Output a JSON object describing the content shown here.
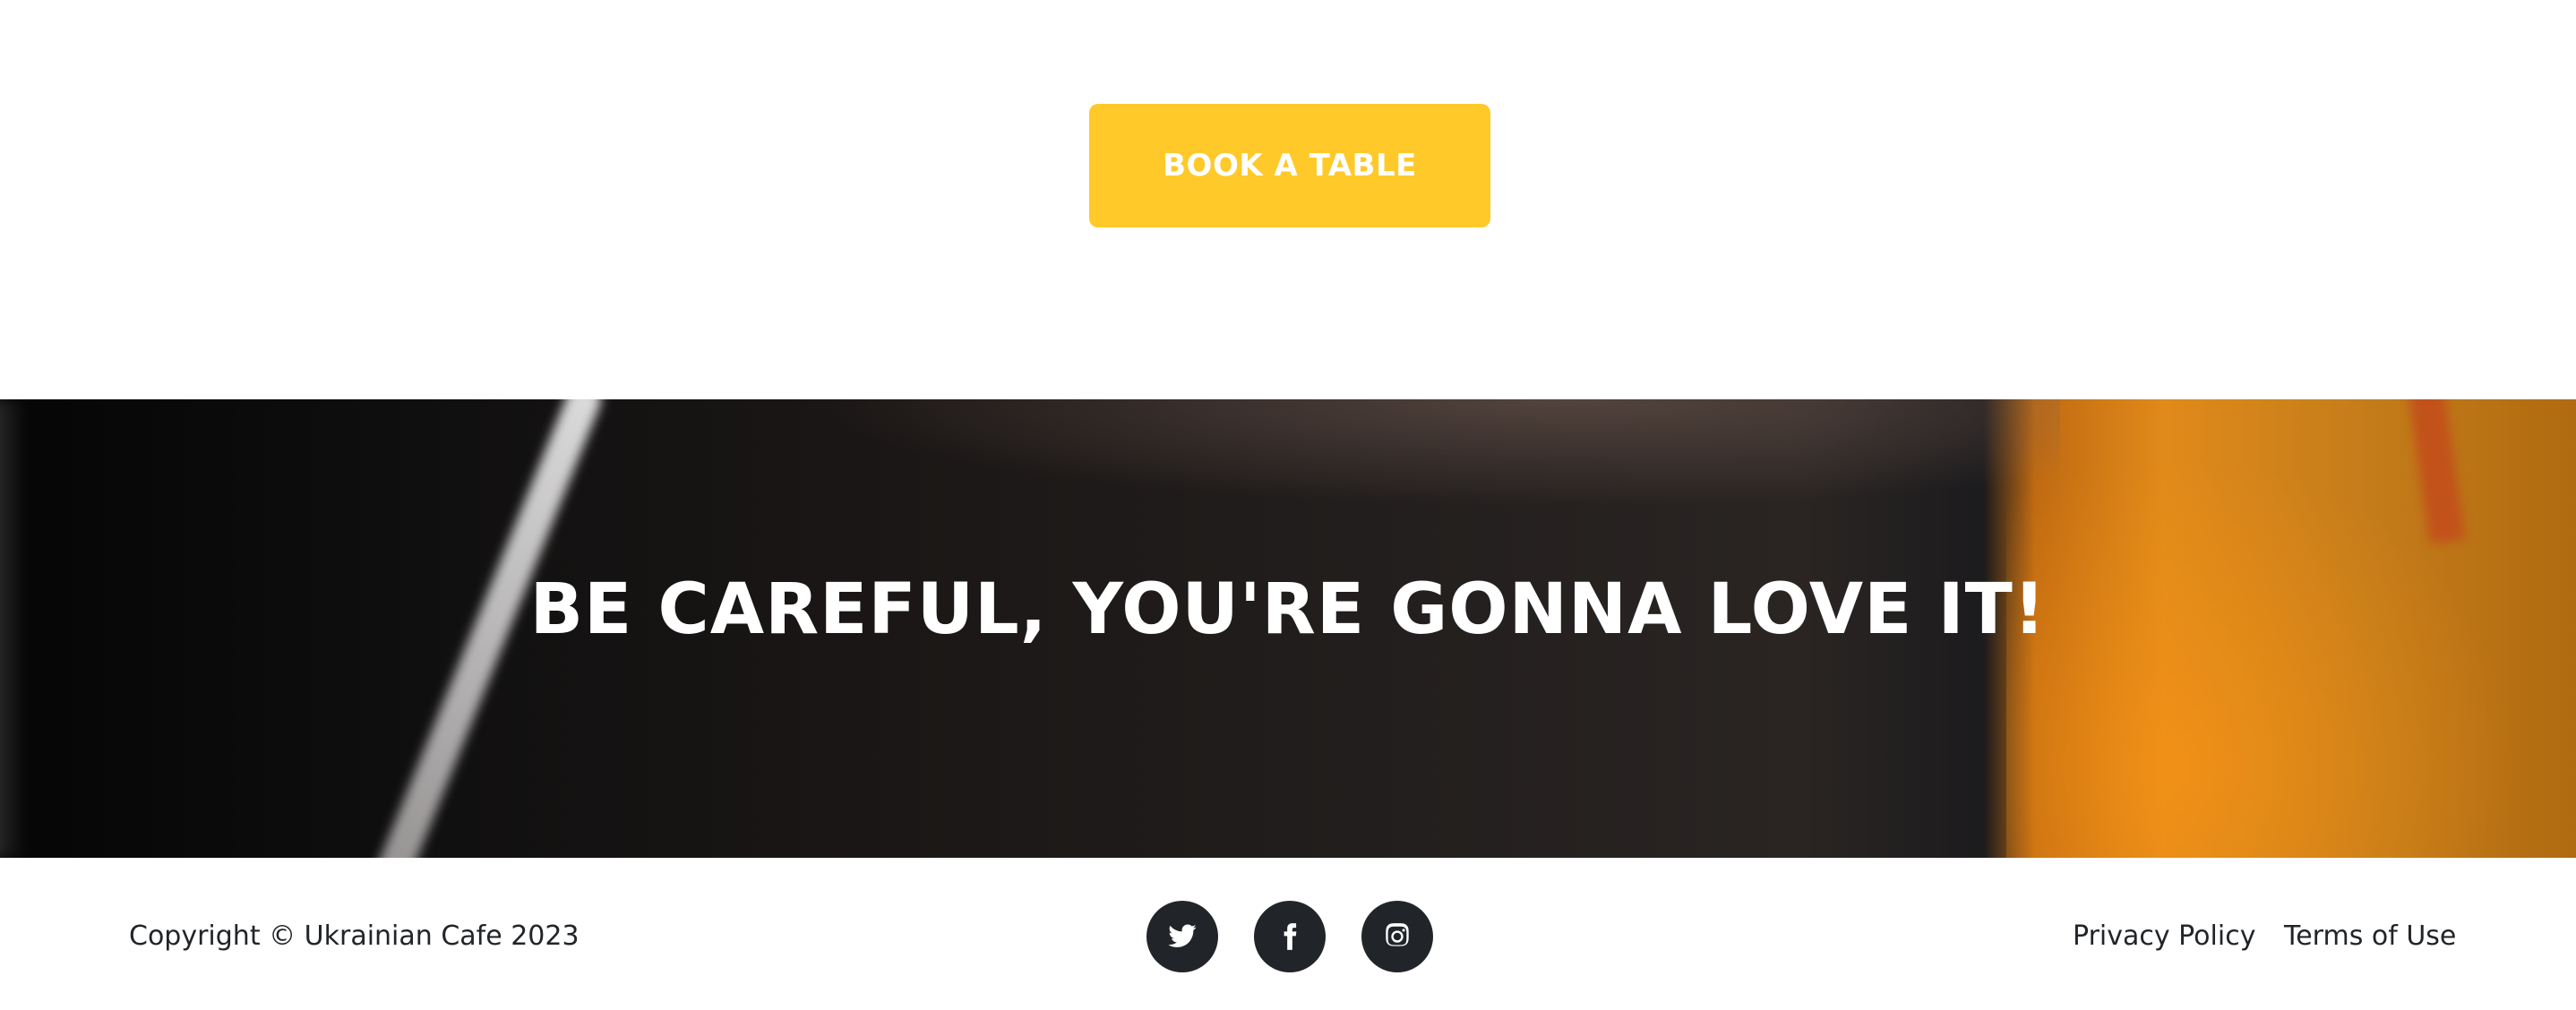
{
  "cta": {
    "book_label": "BOOK A TABLE",
    "button_color": "#ffc929"
  },
  "hero": {
    "title": "BE CAREFUL, YOU'RE GONNA LOVE IT!"
  },
  "footer": {
    "copyright": "Copyright © Ukrainian Cafe 2023",
    "social": [
      {
        "icon": "twitter-icon"
      },
      {
        "icon": "facebook-icon"
      },
      {
        "icon": "instagram-icon"
      }
    ],
    "links": {
      "privacy": "Privacy Policy",
      "terms": "Terms of Use"
    }
  }
}
